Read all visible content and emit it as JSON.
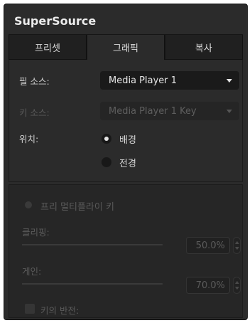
{
  "panel": {
    "title": "SuperSource",
    "tabs": [
      {
        "label": "프리셋",
        "active": false
      },
      {
        "label": "그래픽",
        "active": true
      },
      {
        "label": "복사",
        "active": false
      }
    ]
  },
  "graphics": {
    "fill_source": {
      "label": "필 소스:",
      "value": "Media Player 1"
    },
    "key_source": {
      "label": "키 소스:",
      "value": "Media Player 1 Key",
      "enabled": false
    },
    "position": {
      "label": "위치:",
      "options": [
        {
          "label": "배경",
          "selected": true
        },
        {
          "label": "전경",
          "selected": false
        }
      ]
    }
  },
  "premultiplied_key": {
    "label": "프리 멀티플라이 키",
    "enabled": false,
    "clip": {
      "label": "클리핑:",
      "value": "50.0%",
      "fraction": 0.5
    },
    "gain": {
      "label": "게인:",
      "value": "70.0%",
      "fraction": 0.7
    },
    "invert_key": {
      "label": "키의 반전:",
      "checked": false
    }
  },
  "colors": {
    "panel_bg": "#2b2b2b",
    "dropdown_bg": "#1a1a1a",
    "text": "#d4d4d4",
    "disabled_text": "#5a5a5a"
  }
}
